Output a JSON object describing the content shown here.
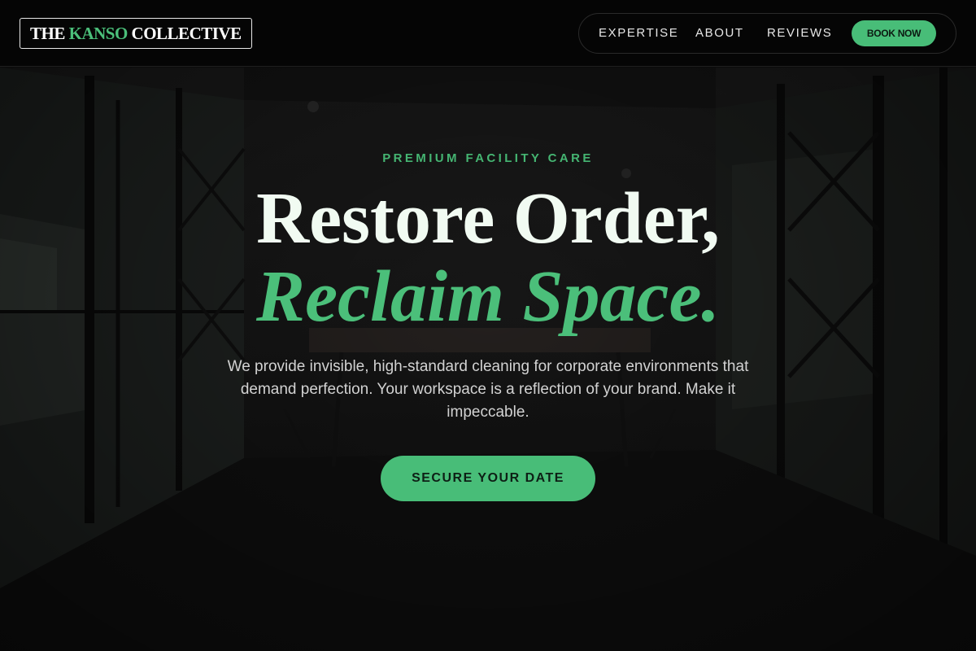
{
  "brand": {
    "logo_part1": "THE ",
    "logo_accent": "KANSO",
    "logo_part2": " COLLECTIVE",
    "accent_color": "#4bbf7a"
  },
  "nav": {
    "links": [
      "EXPERTISE",
      "ABOUT",
      "REVIEWS"
    ],
    "book_label": "BOOK NOW"
  },
  "hero": {
    "eyebrow": "PREMIUM FACILITY CARE",
    "headline_line1": "Restore Order,",
    "headline_line2": "Reclaim Space.",
    "lede": "We provide invisible, high-standard cleaning for corporate environments that demand perfection. Your workspace is a reflection of your brand. Make it impeccable.",
    "cta_label": "SECURE YOUR DATE",
    "background": "dark-office-interior-photo"
  }
}
